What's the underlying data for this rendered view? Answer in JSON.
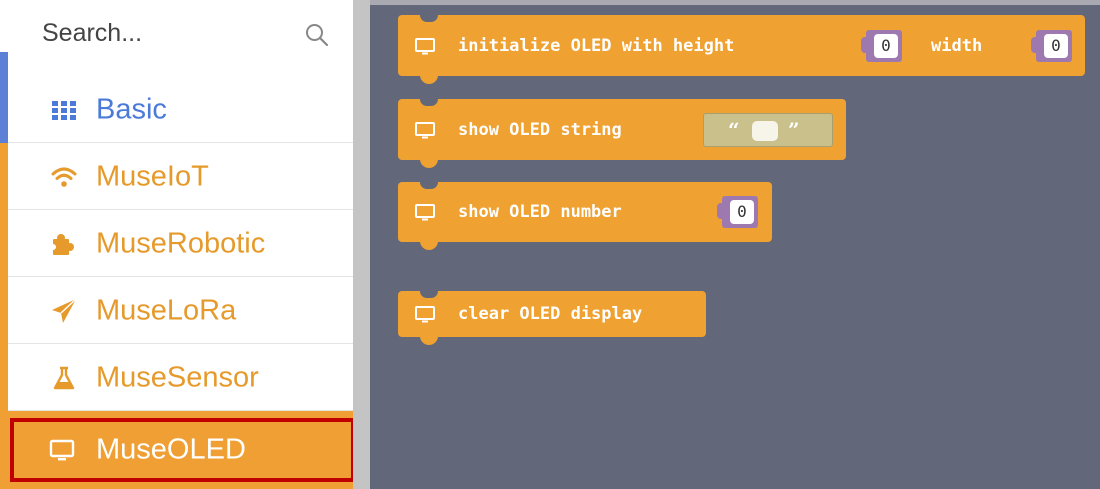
{
  "sidebar": {
    "search": {
      "placeholder": "Search..."
    },
    "categories": [
      {
        "label": "Basic",
        "icon": "grid-icon",
        "color": "#5b80d6"
      },
      {
        "label": "MuseIoT",
        "icon": "wifi-icon",
        "color": "#f0a030"
      },
      {
        "label": "MuseRobotic",
        "icon": "puzzle-icon",
        "color": "#f0a030"
      },
      {
        "label": "MuseLoRa",
        "icon": "send-icon",
        "color": "#f0a030"
      },
      {
        "label": "MuseSensor",
        "icon": "flask-icon",
        "color": "#f0a030"
      },
      {
        "label": "MuseOLED",
        "icon": "monitor-icon",
        "color": "#f0a030",
        "selected": true
      }
    ]
  },
  "workspace": {
    "background": "#63677a",
    "block_color": "#efa131",
    "blocks": [
      {
        "text": "initialize OLED with height",
        "text2": "width",
        "value1": "0",
        "value2": "0"
      },
      {
        "text": "show OLED string",
        "open_quote": "“",
        "close_quote": "”"
      },
      {
        "text": "show OLED number",
        "value1": "0"
      },
      {
        "text": "clear OLED display"
      }
    ]
  }
}
